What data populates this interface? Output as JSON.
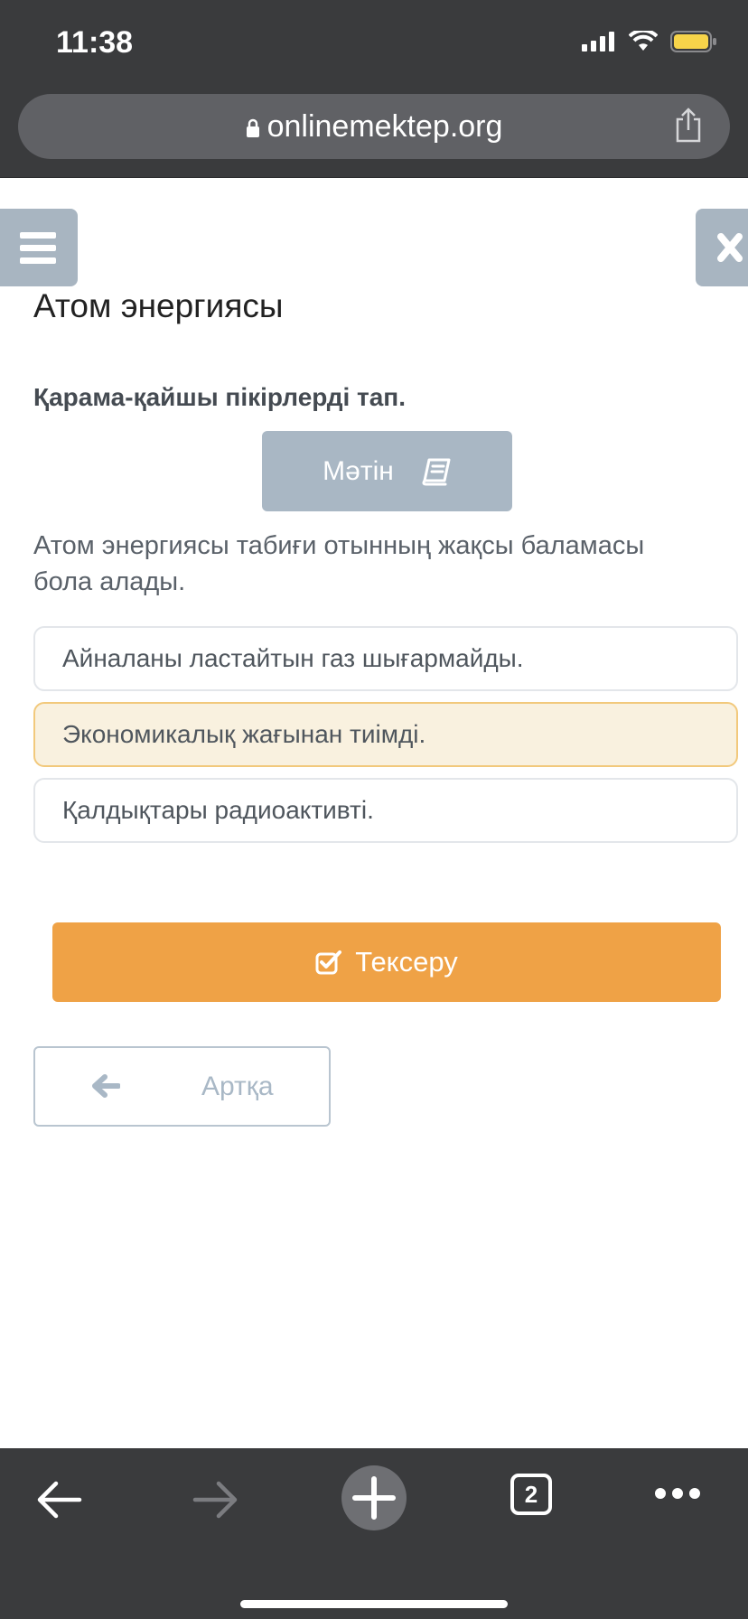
{
  "status_bar": {
    "time": "11:38"
  },
  "browser": {
    "url": "onlinemektep.org"
  },
  "lesson": {
    "title": "Атом энергиясы",
    "question": "Қарама-қайшы пікірлерді тап.",
    "text_button": "Мәтін",
    "statement": "Атом энергиясы табиғи отынның жақсы баламасы бола алады.",
    "options": [
      {
        "label": "Айналаны ластайтын газ шығармайды.",
        "selected": false
      },
      {
        "label": "Экономикалық жағынан тиімді.",
        "selected": true
      },
      {
        "label": "Қалдықтары радиоактивті.",
        "selected": false
      }
    ],
    "check_button": "Тексеру",
    "back_button": "Артқа"
  },
  "bottom_bar": {
    "tabs_count": "2"
  },
  "colors": {
    "check_button": "#efa246",
    "selected_option_bg": "#f9f1df",
    "selected_option_border": "#f2c97c",
    "side_buttons": "#a8b5c1"
  }
}
